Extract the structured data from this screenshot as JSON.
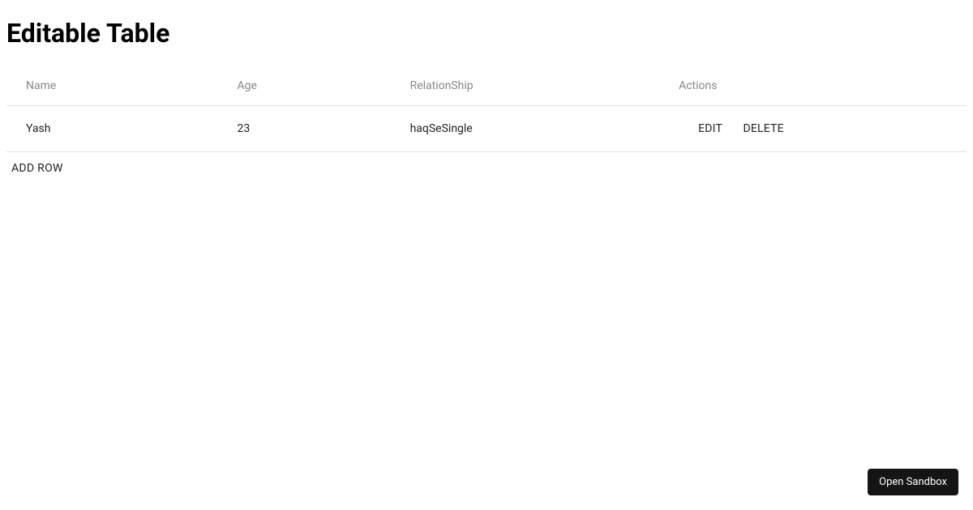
{
  "title": "Editable Table",
  "columns": {
    "name": "Name",
    "age": "Age",
    "relationship": "RelationShip",
    "actions": "Actions"
  },
  "rows": [
    {
      "name": "Yash",
      "age": "23",
      "relationship": "haqSeSingle"
    }
  ],
  "buttons": {
    "edit": "EDIT",
    "delete": "DELETE",
    "addRow": "ADD ROW",
    "openSandbox": "Open Sandbox"
  }
}
